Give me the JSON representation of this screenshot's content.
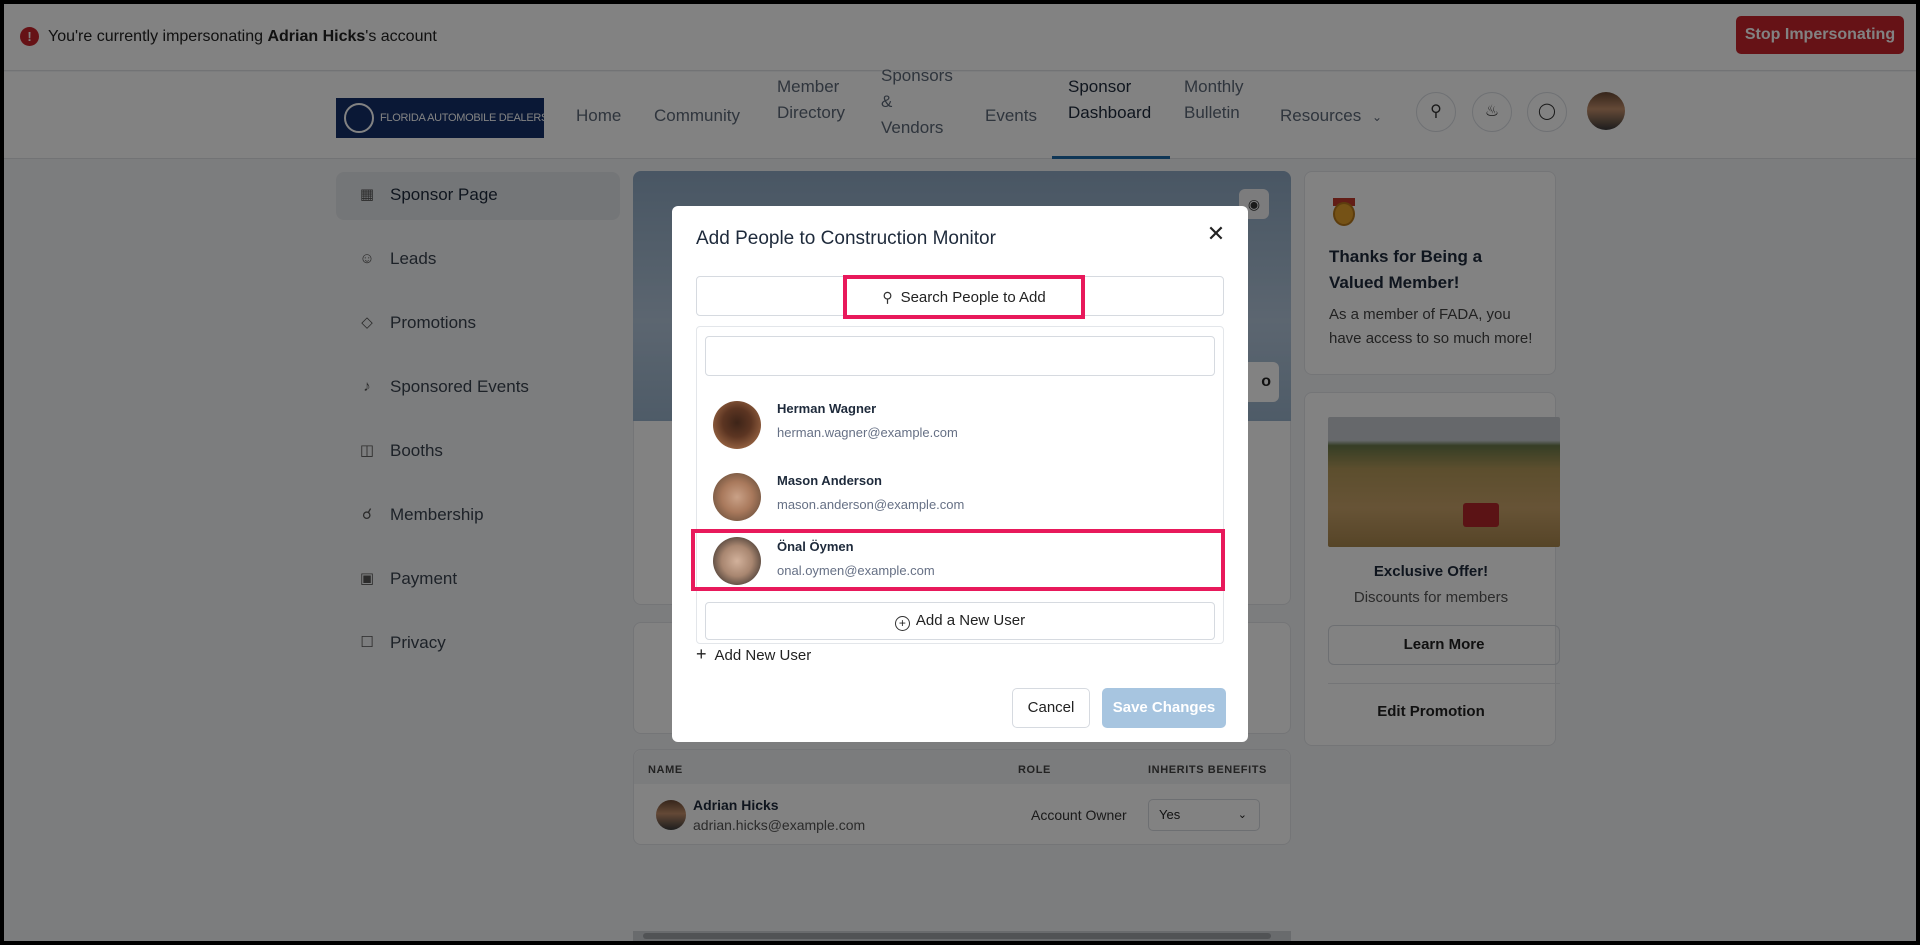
{
  "impersonation": {
    "prefix": "You're currently impersonating ",
    "name": "Adrian Hicks",
    "suffix": "'s account",
    "stop_label": "Stop Impersonating"
  },
  "nav": {
    "logo_text": "FLORIDA AUTOMOBILE DEALERS ASSOCIATION",
    "items": [
      {
        "lines": [
          "Home"
        ]
      },
      {
        "lines": [
          "Community"
        ]
      },
      {
        "lines": [
          "Member",
          "Directory"
        ]
      },
      {
        "lines": [
          "Sponsors",
          "&",
          "Vendors"
        ]
      },
      {
        "lines": [
          "Events"
        ]
      },
      {
        "lines": [
          "Sponsor",
          "Dashboard"
        ]
      },
      {
        "lines": [
          "Monthly",
          "Bulletin"
        ]
      },
      {
        "lines": [
          "Resources"
        ]
      }
    ],
    "icons": [
      "search-icon",
      "bell-icon",
      "chat-icon"
    ]
  },
  "sidebar": {
    "items": [
      {
        "label": "Sponsor Page",
        "icon": "layout-icon"
      },
      {
        "label": "Leads",
        "icon": "users-icon"
      },
      {
        "label": "Promotions",
        "icon": "tag-icon"
      },
      {
        "label": "Sponsored Events",
        "icon": "mic-icon"
      },
      {
        "label": "Booths",
        "icon": "video-icon"
      },
      {
        "label": "Membership",
        "icon": "award-icon"
      },
      {
        "label": "Payment",
        "icon": "credit-card-icon"
      },
      {
        "label": "Privacy",
        "icon": "lock-icon"
      }
    ]
  },
  "banner": {
    "button_partial": "o"
  },
  "thanks": {
    "title": "Thanks for Being a Valued Member!",
    "body": "As a member of FADA, you have access to so much more!"
  },
  "offer": {
    "title": "Exclusive Offer!",
    "subtitle": "Discounts for members",
    "learn_more": "Learn More",
    "edit_promotion": "Edit Promotion"
  },
  "table": {
    "headers": {
      "name": "NAME",
      "role": "ROLE",
      "inherits": "INHERITS BENEFITS"
    },
    "rows": [
      {
        "name": "Adrian Hicks",
        "email": "adrian.hicks@example.com",
        "role": "Account Owner",
        "inherits": "Yes"
      }
    ]
  },
  "modal": {
    "title": "Add People to Construction Monitor",
    "search_label": "Search People to Add",
    "people": [
      {
        "name": "Herman Wagner",
        "email": "herman.wagner@example.com",
        "highlighted": false
      },
      {
        "name": "Mason Anderson",
        "email": "mason.anderson@example.com",
        "highlighted": false
      },
      {
        "name": "Önal Öymen",
        "email": "onal.oymen@example.com",
        "highlighted": true
      }
    ],
    "add_user_label": "Add a New User",
    "add_new_link": "Add New User",
    "cancel_label": "Cancel",
    "save_label": "Save Changes"
  },
  "colors": {
    "accent": "#1f6aa9",
    "danger": "#c9252c",
    "highlight": "#e8195b"
  }
}
